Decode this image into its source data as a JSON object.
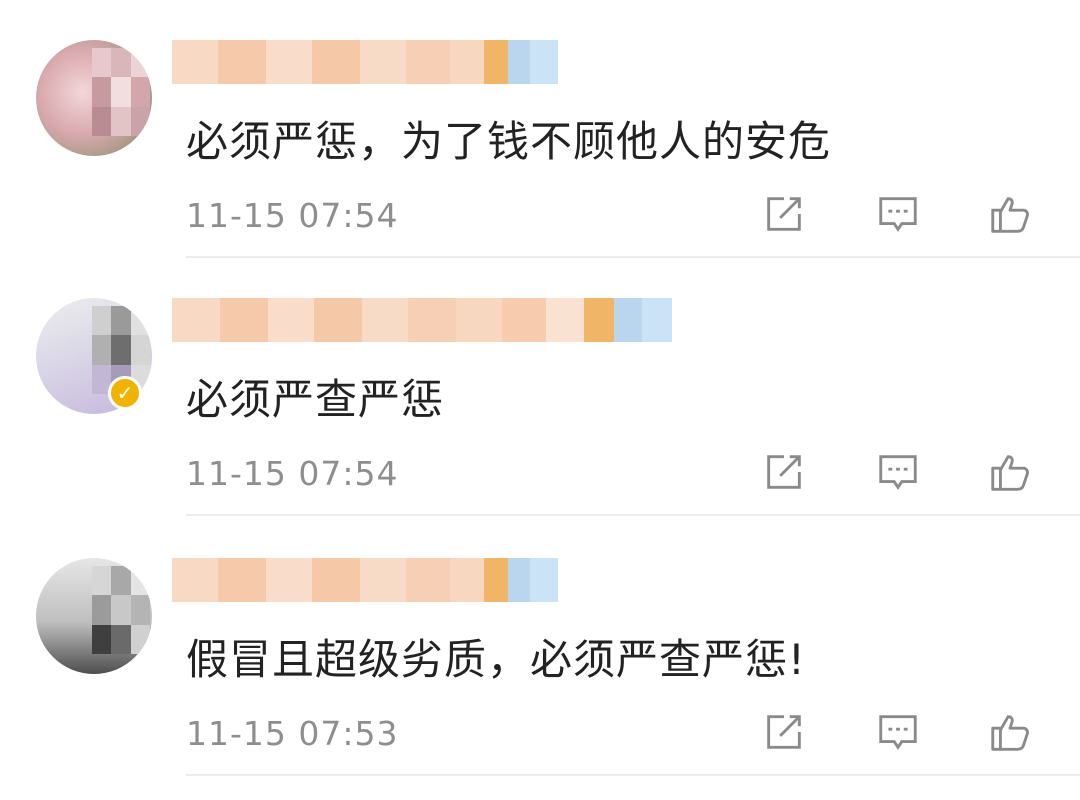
{
  "comments": [
    {
      "text": "必须严惩，为了钱不顾他人的安危",
      "time": "11-15 07:54",
      "verified": false
    },
    {
      "text": "必须严查严惩",
      "time": "11-15 07:54",
      "verified": true
    },
    {
      "text": "假冒且超级劣质，必须严查严惩!",
      "time": "11-15 07:53",
      "verified": false
    }
  ],
  "icons": {
    "share": "share-icon",
    "reply": "comment-icon",
    "like": "thumbs-up-icon"
  },
  "colors": {
    "text": "#222222",
    "meta": "#8e8e8e",
    "icon": "#8a8a8a",
    "verified_badge": "#f2b200"
  }
}
